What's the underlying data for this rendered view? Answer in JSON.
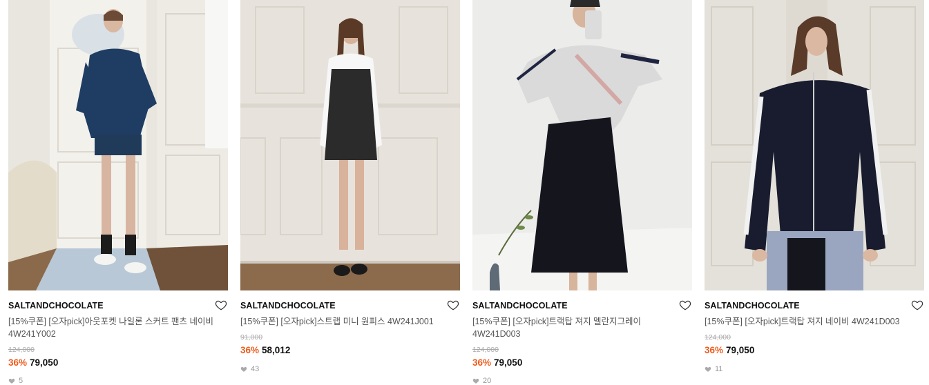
{
  "products": [
    {
      "brand": "SALTANDCHOCOLATE",
      "title": "[15%쿠폰] [오자pick]아웃포켓 나일론 스커트 팬츠 네이비 4W241Y002",
      "original_price": "124,000",
      "discount": "36%",
      "price": "79,050",
      "likes": "5"
    },
    {
      "brand": "SALTANDCHOCOLATE",
      "title": "[15%쿠폰] [오자pick]스트랩 미니 원피스 4W241J001",
      "original_price": "91,000",
      "discount": "36%",
      "price": "58,012",
      "likes": "43"
    },
    {
      "brand": "SALTANDCHOCOLATE",
      "title": "[15%쿠폰] [오자pick]트랙탑 져지 멜란지그레이 4W241D003",
      "original_price": "124,000",
      "discount": "36%",
      "price": "79,050",
      "likes": "20"
    },
    {
      "brand": "SALTANDCHOCOLATE",
      "title": "[15%쿠폰] [오자pick]트랙탑 져지 네이비 4W241D003",
      "original_price": "124,000",
      "discount": "36%",
      "price": "79,050",
      "likes": "11"
    }
  ],
  "icons": {
    "wishlist": "heart-outline-icon",
    "likes": "heart-filled-icon"
  },
  "colors": {
    "discount": "#ef5b1c",
    "strike": "#aaaaaa",
    "title": "#555555"
  }
}
